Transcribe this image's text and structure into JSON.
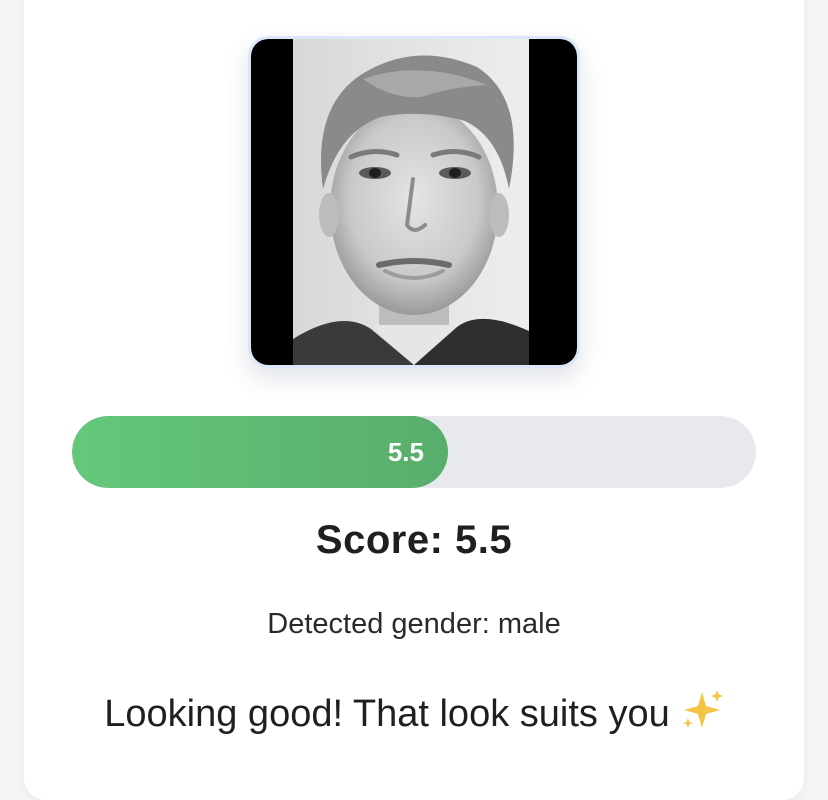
{
  "result": {
    "photo_alt": "Uploaded face photo",
    "score_value": 5.5,
    "score_max": 10,
    "bar_label": "5.5",
    "score_text": "Score: 5.5",
    "gender_text": "Detected gender: male",
    "message_text": "Looking good! That look suits you",
    "message_icon": "sparkles-icon"
  },
  "colors": {
    "bar_fill_start": "#64c87a",
    "bar_fill_end": "#58ad6b",
    "bar_track": "#e8e9ed",
    "photo_border": "#dbe8fb",
    "sparkle": "#f4c542"
  }
}
